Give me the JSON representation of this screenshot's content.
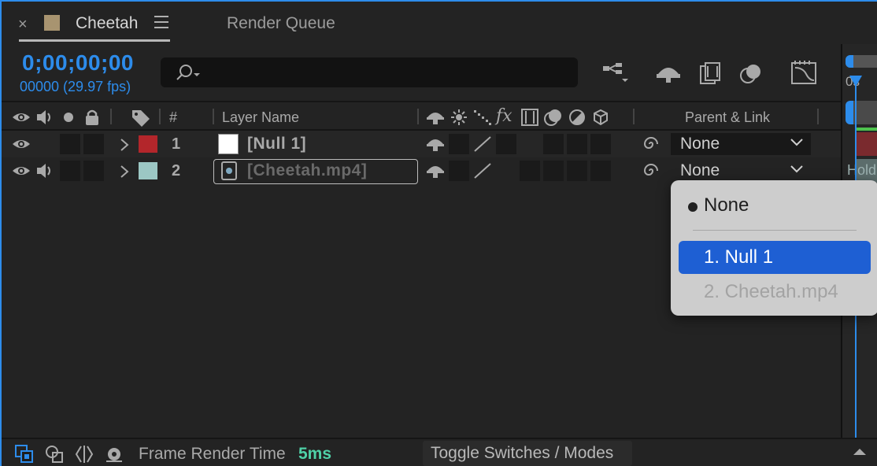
{
  "tabs": {
    "close_glyph": "×",
    "active_title": "Cheetah",
    "active_swatch_color": "#a89470",
    "render_queue": "Render Queue"
  },
  "time": {
    "timecode": "0;00;00;00",
    "frames": "00000 (29.97 fps)",
    "accent_color": "#2d8ceb"
  },
  "search": {
    "placeholder": "",
    "icon": "search-icon"
  },
  "toolbar": {
    "icons": [
      "composition-flowchart-icon",
      "draft-3d-icon",
      "frame-blending-icon",
      "motion-blur-icon",
      "graph-editor-icon"
    ]
  },
  "columns": {
    "number": "#",
    "layer_name": "Layer Name",
    "fx": "fx",
    "parent_link": "Parent & Link"
  },
  "layers": [
    {
      "number": "1",
      "name": "[Null 1]",
      "label_color": "#b3262b"
    },
    {
      "number": "2",
      "name": "[Cheetah.mp4]",
      "label_color": "#9cc7c4"
    }
  ],
  "parent": {
    "row1_value": "None",
    "row2_value": "None"
  },
  "popup": {
    "options": [
      "None",
      "1. Null 1",
      "2. Cheetah.mp4"
    ],
    "selected_index": 0,
    "highlighted_index": 1,
    "disabled_index": 2
  },
  "timeline": {
    "time_label": "0s",
    "hold_text": "Hold"
  },
  "footer": {
    "frame_render_label": "Frame Render Time",
    "frame_render_value": "5ms",
    "toggle_label": "Toggle Switches / Modes"
  }
}
